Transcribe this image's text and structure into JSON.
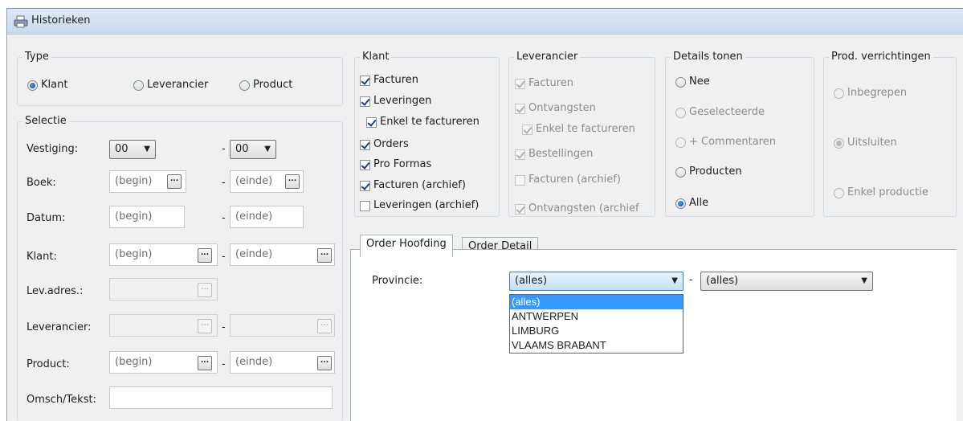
{
  "window": {
    "title": "Historieken"
  },
  "type_group": {
    "legend": "Type",
    "options": [
      "Klant",
      "Leverancier",
      "Product"
    ],
    "selected": "Klant"
  },
  "selectie": {
    "legend": "Selectie",
    "vestiging": {
      "label": "Vestiging:",
      "from": "00",
      "to": "00"
    },
    "boek": {
      "label": "Boek:",
      "from": "(begin)",
      "to": "(einde)"
    },
    "datum": {
      "label": "Datum:",
      "from": "(begin)",
      "to": "(einde)"
    },
    "klant": {
      "label": "Klant:",
      "from": "(begin)",
      "to": "(einde)"
    },
    "lev_adres": {
      "label": "Lev.adres.:"
    },
    "leverancier": {
      "label": "Leverancier:"
    },
    "product": {
      "label": "Product:",
      "from": "(begin)",
      "to": "(einde)"
    },
    "omsch": {
      "label": "Omsch/Tekst:",
      "value": ""
    },
    "dash": "-",
    "dots": "..."
  },
  "klant_group": {
    "legend": "Klant",
    "items": [
      {
        "label": "Facturen",
        "checked": true
      },
      {
        "label": "Leveringen",
        "checked": true
      },
      {
        "label": "Enkel te factureren",
        "checked": true
      },
      {
        "label": "Orders",
        "checked": true
      },
      {
        "label": "Pro Formas",
        "checked": true
      },
      {
        "label": "Facturen (archief)",
        "checked": true
      },
      {
        "label": "Leveringen (archief)",
        "checked": false
      }
    ]
  },
  "leverancier_group": {
    "legend": "Leverancier",
    "items": [
      {
        "label": "Facturen",
        "checked": true
      },
      {
        "label": "Ontvangsten",
        "checked": true
      },
      {
        "label": "Enkel te factureren",
        "checked": true
      },
      {
        "label": "Bestellingen",
        "checked": true
      },
      {
        "label": "Facturen (archief)",
        "checked": false
      },
      {
        "label": "Ontvangsten (archief",
        "checked": true
      }
    ]
  },
  "details_group": {
    "legend": "Details tonen",
    "options": [
      "Nee",
      "Geselecteerde",
      "+ Commentaren",
      "Producten",
      "Alle"
    ],
    "selected": "Alle"
  },
  "prod_group": {
    "legend": "Prod. verrichtingen",
    "options": [
      "Inbegrepen",
      "Uitsluiten",
      "Enkel productie"
    ],
    "selected": "Uitsluiten"
  },
  "tabs": [
    {
      "label": "Order Hoofding",
      "active": true
    },
    {
      "label": "Order Detail",
      "active": false
    }
  ],
  "provincie": {
    "label": "Provincie:",
    "from": "(alles)",
    "to": "(alles)",
    "dash": "-",
    "dropdown_options": [
      "(alles)",
      "ANTWERPEN",
      "LIMBURG",
      "VLAAMS BRABANT"
    ],
    "highlighted": "(alles)"
  }
}
